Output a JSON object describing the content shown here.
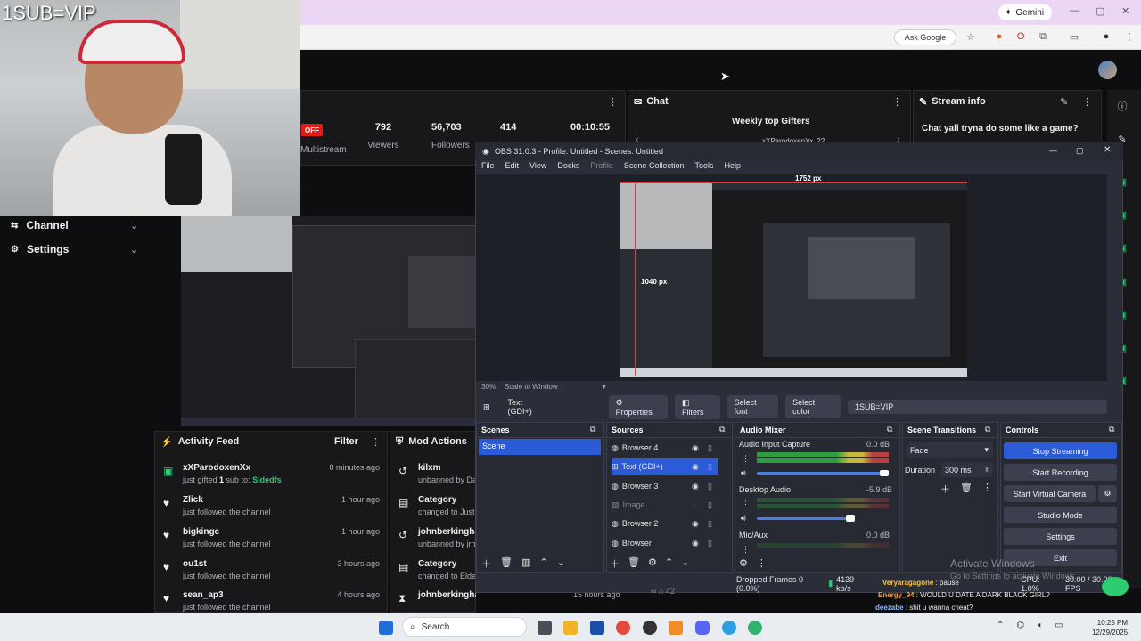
{
  "webcam": {
    "overlay_text": "1SUB=VIP"
  },
  "browser": {
    "gemini_label": "Gemini",
    "ask_google": "Ask Google"
  },
  "stats": {
    "badge": "OFF",
    "multistream": "Multistream",
    "viewers_value": "792",
    "viewers_label": "Viewers",
    "followers_value": "56,703",
    "followers_label": "Followers",
    "subs_value": "414",
    "uptime_value": "00:10:55"
  },
  "chat": {
    "title": "Chat",
    "top_gifters": "Weekly top Gifters",
    "gifter_name": "xXParodoxenXx",
    "gifter_count": "22"
  },
  "stream_info": {
    "title": "Stream info",
    "stream_title": "Chat yall tryna do some like a game?"
  },
  "sidebar": {
    "items": [
      {
        "label": "Channel"
      },
      {
        "label": "Settings"
      }
    ]
  },
  "activity_feed": {
    "title": "Activity Feed",
    "filter": "Filter",
    "items": [
      {
        "name": "xXParodoxenXx",
        "desc_prefix": "just gifted ",
        "desc_count": "1",
        "desc_mid": " sub to: ",
        "desc_target": "Sidedfs",
        "time": "8 minutes ago",
        "icon": "gift-icon"
      },
      {
        "name": "Zlick",
        "desc": "just followed the channel",
        "time": "1 hour ago",
        "icon": "heart-icon"
      },
      {
        "name": "bigkingc",
        "desc": "just followed the channel",
        "time": "1 hour ago",
        "icon": "heart-icon"
      },
      {
        "name": "ou1st",
        "desc": "just followed the channel",
        "time": "3 hours ago",
        "icon": "heart-icon"
      },
      {
        "name": "sean_ap3",
        "desc": "just followed the channel",
        "time": "4 hours ago",
        "icon": "heart-icon"
      }
    ]
  },
  "mod_actions": {
    "title": "Mod Actions",
    "items": [
      {
        "name": "kilxm",
        "desc": "unbanned by Da"
      },
      {
        "name": "Category",
        "desc": "changed to Just"
      },
      {
        "name": "johnberkingha",
        "desc": "unbanned by jrn"
      },
      {
        "name": "Category",
        "desc": "changed to Elde"
      },
      {
        "name": "johnberkingham",
        "desc": ""
      }
    ],
    "last_time": "15 hours ago"
  },
  "obs": {
    "title": "OBS 31.0.3 - Profile: Untitled - Scenes: Untitled",
    "menu": [
      "File",
      "Edit",
      "View",
      "Docks",
      "Profile",
      "Scene Collection",
      "Tools",
      "Help"
    ],
    "width_label": "1752 px",
    "height_label": "1040 px",
    "zoom": "30%",
    "scale_mode": "Scale to Window",
    "source_name": "Text (GDI+)",
    "properties": "Properties",
    "filters": "Filters",
    "select_font": "Select font",
    "select_color": "Select color",
    "text_value": "1SUB=VIP",
    "scenes_title": "Scenes",
    "scenes": [
      "Scene"
    ],
    "sources_title": "Sources",
    "sources": [
      {
        "name": "Browser 4",
        "selected": false,
        "hidden": false
      },
      {
        "name": "Text (GDI+)",
        "selected": true,
        "hidden": false
      },
      {
        "name": "Browser 3",
        "selected": false,
        "hidden": false
      },
      {
        "name": "Image",
        "selected": false,
        "hidden": true
      },
      {
        "name": "Browser 2",
        "selected": false,
        "hidden": false
      },
      {
        "name": "Browser",
        "selected": false,
        "hidden": false
      }
    ],
    "mixer_title": "Audio Mixer",
    "mixer": [
      {
        "name": "Audio Input Capture",
        "db": "0.0 dB"
      },
      {
        "name": "Desktop Audio",
        "db": "-5.9 dB"
      },
      {
        "name": "Mic/Aux",
        "db": "0.0 dB"
      }
    ],
    "transitions_title": "Scene Transitions",
    "transition": "Fade",
    "duration_label": "Duration",
    "duration_value": "300 ms",
    "controls_title": "Controls",
    "controls": [
      "Stop Streaming",
      "Start Recording",
      "Start Virtual Camera",
      "Studio Mode",
      "Settings",
      "Exit"
    ],
    "dropped_frames": "Dropped Frames 0 (0.0%)",
    "bitrate": "4139 kb/s",
    "cpu": "CPU: 1.0%",
    "fps": "30.00 / 30.00 FPS"
  },
  "activate_windows": {
    "title": "Activate Windows",
    "subtitle": "Go to Settings to activate Windows."
  },
  "overlay_chat": [
    {
      "user": "Veryaragagone",
      "text": "pause"
    },
    {
      "user": "Energy_94",
      "text": "WOULD U DATE A DARK BLACK GIRL?"
    },
    {
      "user": "deezabe",
      "text": "shit u wanna cheat?"
    }
  ],
  "taskbar": {
    "search_placeholder": "Search",
    "time": "10:25 PM",
    "date": "12/29/2025"
  },
  "colors": {
    "obs_selected": "#2b5bd7",
    "twitch_bg": "#0e0e10",
    "live_red": "#e91916",
    "follow_green": "#2ecc71"
  }
}
